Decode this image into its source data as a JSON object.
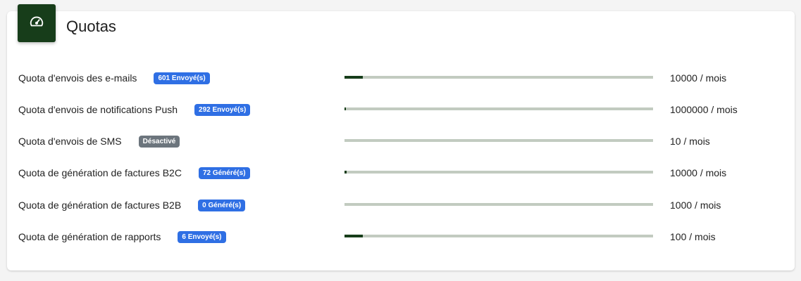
{
  "card": {
    "title": "Quotas",
    "icon": "speedometer-icon"
  },
  "colors": {
    "header_icon_bg": "#173d1a",
    "bar_fill": "#173d1a",
    "bar_track": "#c2cbc0",
    "badge_blue": "#2f6fe4",
    "badge_gray": "#6c757d"
  },
  "quotas": [
    {
      "label": "Quota d'envois des e-mails",
      "badge": "601 Envoyé(s)",
      "badge_color": "blue",
      "limit": "10000 / mois",
      "progress": 0.06
    },
    {
      "label": "Quota d'envois de notifications Push",
      "badge": "292 Envoyé(s)",
      "badge_color": "blue",
      "limit": "1000000 / mois",
      "progress": 0.0003
    },
    {
      "label": "Quota d'envois de SMS",
      "badge": "Désactivé",
      "badge_color": "gray",
      "limit": "10 / mois",
      "progress": 0
    },
    {
      "label": "Quota de génération de factures B2C",
      "badge": "72 Généré(s)",
      "badge_color": "blue",
      "limit": "10000 / mois",
      "progress": 0.0072
    },
    {
      "label": "Quota de génération de factures B2B",
      "badge": "0 Généré(s)",
      "badge_color": "blue",
      "limit": "1000 / mois",
      "progress": 0
    },
    {
      "label": "Quota de génération de rapports",
      "badge": "6 Envoyé(s)",
      "badge_color": "blue",
      "limit": "100 / mois",
      "progress": 0.06
    }
  ]
}
